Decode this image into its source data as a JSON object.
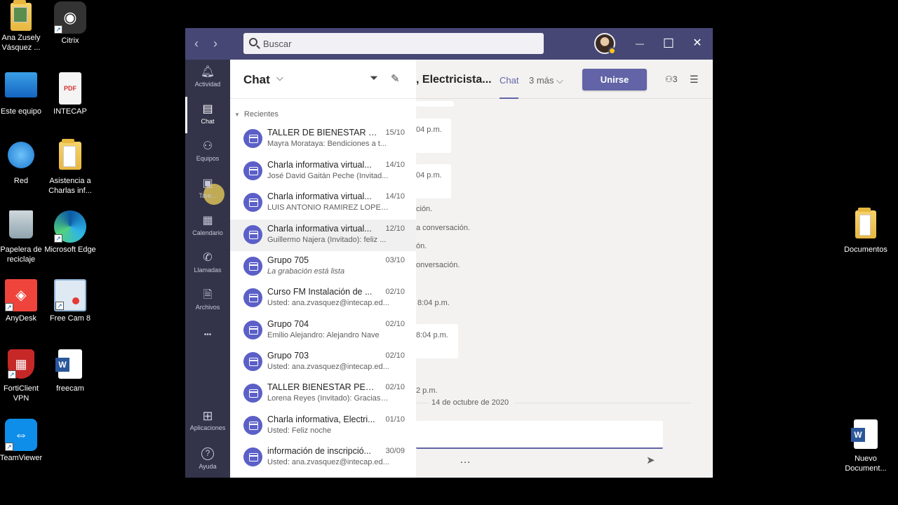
{
  "desktop": {
    "icons_left": [
      {
        "label": "Ana Zusely Vásquez ...",
        "icon": "user-folder-icon"
      },
      {
        "label": "Citrix",
        "icon": "citrix-icon"
      },
      {
        "label": "Este equipo",
        "icon": "computer-icon"
      },
      {
        "label": "INTECAP",
        "icon": "pdf-icon"
      },
      {
        "label": "Red",
        "icon": "network-icon"
      },
      {
        "label": "Asistencia a Charlas inf...",
        "icon": "folder-icon"
      },
      {
        "label": "Papelera de reciclaje",
        "icon": "recycle-bin-icon"
      },
      {
        "label": "Microsoft Edge",
        "icon": "edge-icon"
      },
      {
        "label": "AnyDesk",
        "icon": "anydesk-icon"
      },
      {
        "label": "Free Cam 8",
        "icon": "freecam-icon"
      },
      {
        "label": "FortiClient VPN",
        "icon": "forticlient-icon"
      },
      {
        "label": "freecam",
        "icon": "word-doc-icon"
      },
      {
        "label": "TeamViewer",
        "icon": "teamviewer-icon"
      }
    ],
    "icons_right": [
      {
        "label": "Documentos",
        "icon": "folder-icon"
      },
      {
        "label": "Nuevo Document...",
        "icon": "word-doc-icon"
      }
    ]
  },
  "teams": {
    "search_placeholder": "Buscar",
    "nav_back": "‹",
    "nav_forward": "›",
    "window_controls": {
      "minimize": "—",
      "maximize": "☐",
      "close": "✕"
    },
    "rail": [
      {
        "label": "Actividad",
        "icon": "bell-icon",
        "glyph": "🔔"
      },
      {
        "label": "Chat",
        "icon": "chat-icon",
        "glyph": "💬",
        "active": true
      },
      {
        "label": "Equipos",
        "icon": "teams-icon",
        "glyph": "👥"
      },
      {
        "label": "Tare...",
        "icon": "tasks-icon",
        "glyph": "📋"
      },
      {
        "label": "Calendario",
        "icon": "calendar-icon",
        "glyph": "▦"
      },
      {
        "label": "Llamadas",
        "icon": "phone-icon",
        "glyph": "✆"
      },
      {
        "label": "Archivos",
        "icon": "files-icon",
        "glyph": "🗎"
      },
      {
        "label": "...",
        "icon": "more-icon",
        "glyph": "•••"
      },
      {
        "label": "Aplicaciones",
        "icon": "apps-icon",
        "glyph": "⊞"
      },
      {
        "label": "Ayuda",
        "icon": "help-icon",
        "glyph": "?"
      }
    ],
    "chat_panel": {
      "title": "Chat",
      "section": "Recientes",
      "items": [
        {
          "title": "TALLER DE BIENESTAR PE...",
          "date": "15/10",
          "preview": "Mayra Morataya: Bendiciones a t..."
        },
        {
          "title": "Charla informativa virtual...",
          "date": "14/10",
          "preview": "José David Gaitán Peche (Invitad..."
        },
        {
          "title": "Charla informativa virtual...",
          "date": "14/10",
          "preview": "LUIS ANTONIO RAMIREZ LOPEZ (..."
        },
        {
          "title": "Charla informativa virtual...",
          "date": "12/10",
          "preview": "Guillermo Najera (Invitado): feliz ..."
        },
        {
          "title": "Grupo 705",
          "date": "03/10",
          "preview": "La grabación está lista"
        },
        {
          "title": "Curso FM Instalación de ...",
          "date": "02/10",
          "preview": "Usted: ana.zvasquez@intecap.ed..."
        },
        {
          "title": "Grupo 704",
          "date": "02/10",
          "preview": "Emilio Alejandro: Alejandro Nave"
        },
        {
          "title": "Grupo 703",
          "date": "02/10",
          "preview": "Usted: ana.zvasquez@intecap.ed..."
        },
        {
          "title": "TALLER BIENESTAR PERS...",
          "date": "02/10",
          "preview": "Lorena Reyes (Invitado): Gracias, ..."
        },
        {
          "title": "Charla informativa, Electri...",
          "date": "01/10",
          "preview": "Usted: Feliz noche"
        },
        {
          "title": "información de inscripció...",
          "date": "30/09",
          "preview": "Usted: ana.zvasquez@intecap.ed..."
        }
      ]
    },
    "conversation": {
      "title": ", Electricista...",
      "tab_chat": "Chat",
      "tab_more": "3 más",
      "join_button": "Unirse",
      "participants_count": "3",
      "fragments": [
        "04 p.m.",
        "04 p.m.",
        "ción.",
        "a conversación.",
        "ón.",
        "onversación.",
        "8:04 p.m.",
        "8:04 p.m.",
        "2 p.m."
      ],
      "date_separator": "14 de octubre de 2020"
    }
  }
}
